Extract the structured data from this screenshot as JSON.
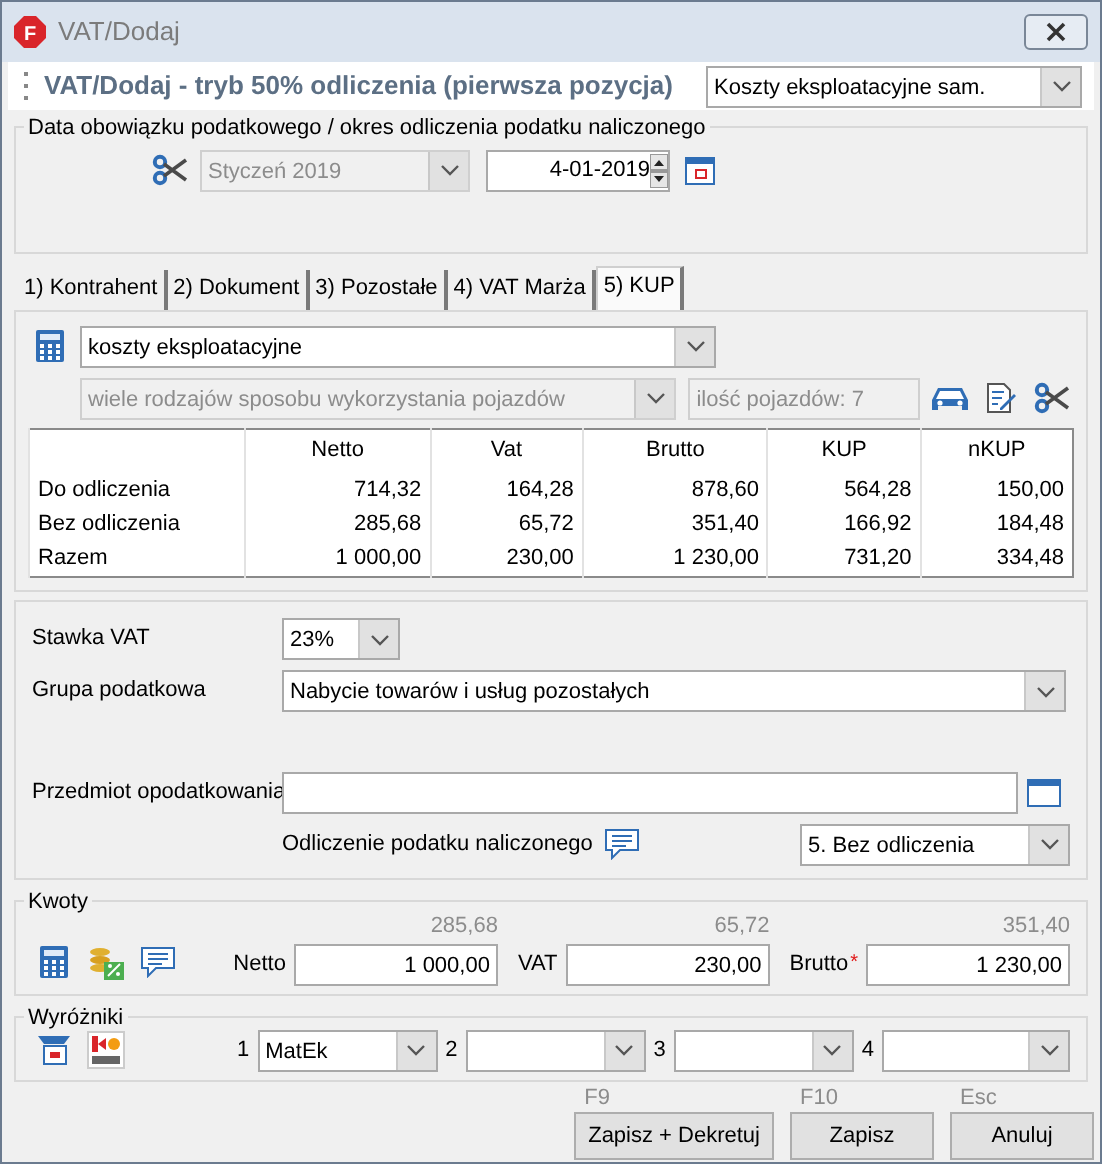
{
  "window": {
    "title": "VAT/Dodaj",
    "icon_letter": "F"
  },
  "header": {
    "title": "VAT/Dodaj - tryb 50% odliczenia (pierwsza pozycja)",
    "category": "Koszty eksploatacyjne sam."
  },
  "date_group": {
    "legend": "Data obowiązku podatkowego / okres odliczenia podatku naliczonego",
    "period": {
      "value": "Styczeń 2019",
      "disabled": true
    },
    "date": "4-01-2019"
  },
  "tabs": [
    {
      "label": "1) Kontrahent",
      "selected": false
    },
    {
      "label": "2) Dokument",
      "selected": false
    },
    {
      "label": "3) Pozostałe",
      "selected": false
    },
    {
      "label": "4) VAT Marża",
      "selected": false
    },
    {
      "label": "5) KUP",
      "selected": true
    }
  ],
  "kup": {
    "cost_type": {
      "value": "koszty eksploatacyjne",
      "disabled": false
    },
    "usage": {
      "value": "wiele rodzajów sposobu wykorzystania pojazdów",
      "disabled": true
    },
    "vehicle_count": "ilość pojazdów: 7",
    "table": {
      "columns": [
        "",
        "Netto",
        "Vat",
        "Brutto",
        "KUP",
        "nKUP"
      ],
      "rows": [
        [
          "Do odliczenia",
          "714,32",
          "164,28",
          "878,60",
          "564,28",
          "150,00"
        ],
        [
          "Bez odliczenia",
          "285,68",
          "65,72",
          "351,40",
          "166,92",
          "184,48"
        ],
        [
          "Razem",
          "1 000,00",
          "230,00",
          "1 230,00",
          "731,20",
          "334,48"
        ]
      ]
    }
  },
  "vat_rate": {
    "label": "Stawka VAT",
    "value": "23%"
  },
  "tax_group": {
    "label": "Grupa podatkowa",
    "value": "Nabycie towarów i usług pozostałych"
  },
  "subject": {
    "label": "Przedmiot opodatkowania"
  },
  "deduction": {
    "label": "Odliczenie podatku naliczonego",
    "value": "5. Bez odliczenia"
  },
  "amounts": {
    "legend": "Kwoty",
    "fields": [
      {
        "label": "Netto",
        "hint": "285,68",
        "value": "1 000,00"
      },
      {
        "label": "VAT",
        "hint": "65,72",
        "value": "230,00"
      },
      {
        "label": "Brutto",
        "required_mark": "*",
        "hint": "351,40",
        "value": "1 230,00"
      }
    ]
  },
  "markers": {
    "legend": "Wyróżniki",
    "slots": [
      {
        "number": "1",
        "value": "MatEk"
      },
      {
        "number": "2"
      },
      {
        "number": "3"
      },
      {
        "number": "4"
      }
    ]
  },
  "buttons": [
    {
      "shortcut": "F9",
      "label": "Zapisz + Dekretuj"
    },
    {
      "shortcut": "F10",
      "label": "Zapisz"
    },
    {
      "shortcut": "Esc",
      "label": "Anuluj"
    }
  ]
}
